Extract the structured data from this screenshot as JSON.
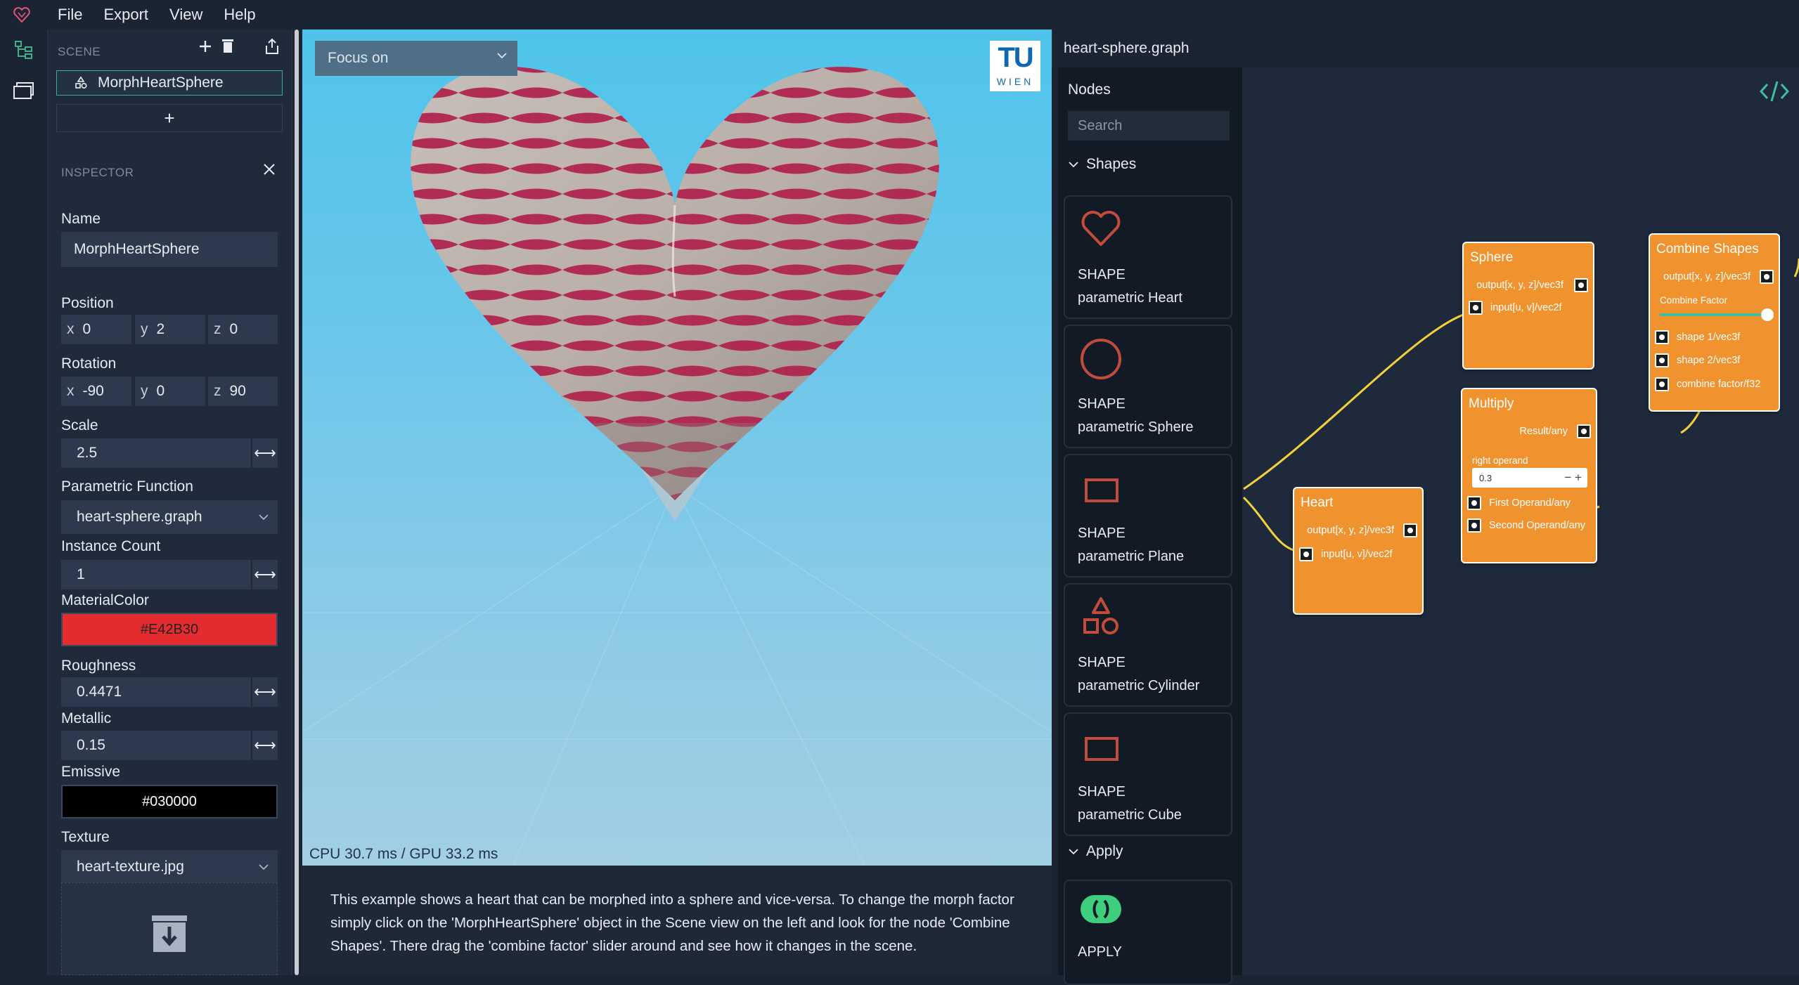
{
  "menu": {
    "items": [
      "File",
      "Export",
      "View",
      "Help"
    ]
  },
  "scene": {
    "header": "SCENE",
    "selected_item": "MorphHeartSphere",
    "add_label": "+"
  },
  "inspector": {
    "header": "INSPECTOR",
    "name_label": "Name",
    "name_value": "MorphHeartSphere",
    "position_label": "Position",
    "position": {
      "x": "0",
      "y": "2",
      "z": "0"
    },
    "rotation_label": "Rotation",
    "rotation": {
      "x": "-90",
      "y": "0",
      "z": "90"
    },
    "scale_label": "Scale",
    "scale_value": "2.5",
    "param_fn_label": "Parametric Function",
    "param_fn_value": "heart-sphere.graph",
    "instance_label": "Instance Count",
    "instance_value": "1",
    "material_label": "MaterialColor",
    "material_value": "#E42B30",
    "roughness_label": "Roughness",
    "roughness_value": "0.4471",
    "metallic_label": "Metallic",
    "metallic_value": "0.15",
    "emissive_label": "Emissive",
    "emissive_value": "#030000",
    "texture_label": "Texture",
    "texture_value": "heart-texture.jpg",
    "axis": {
      "x": "x",
      "y": "y",
      "z": "z"
    }
  },
  "viewport": {
    "focus_label": "Focus on",
    "perf": "CPU 30.7 ms / GPU 33.2 ms",
    "logo_top": "TU",
    "logo_bottom": "WIEN"
  },
  "description": "This example shows a heart that can be morphed into a sphere and vice-versa. To change the morph factor simply click on the 'MorphHeartSphere' object in the Scene view on the left and look for the node 'Combine Shapes'. There drag the 'combine factor' slider around and see how it changes in the scene.",
  "graph": {
    "filename": "heart-sphere.graph",
    "nodes_title": "Nodes",
    "search_placeholder": "Search",
    "categories": {
      "shapes": "Shapes",
      "apply": "Apply"
    },
    "cards": [
      {
        "kind": "SHAPE",
        "name": "parametric Heart",
        "icon": "heart-icon"
      },
      {
        "kind": "SHAPE",
        "name": "parametric Sphere",
        "icon": "circle-icon"
      },
      {
        "kind": "SHAPE",
        "name": "parametric Plane",
        "icon": "rectangle-icon"
      },
      {
        "kind": "SHAPE",
        "name": "parametric Cylinder",
        "icon": "shapes-icon"
      },
      {
        "kind": "SHAPE",
        "name": "parametric Cube",
        "icon": "square-icon"
      },
      {
        "kind": "APPLY",
        "name": "",
        "icon": "apply-icon"
      }
    ],
    "node_heart": {
      "title": "Heart",
      "out": "output[x, y, z]/vec3f",
      "in": "input[u, v]/vec2f"
    },
    "node_sphere": {
      "title": "Sphere",
      "out": "output[x, y, z]/vec3f",
      "in": "input[u, v]/vec2f"
    },
    "node_multiply": {
      "title": "Multiply",
      "out": "Result/any",
      "right_label": "right operand",
      "right_value": "0.3",
      "in1": "First Operand/any",
      "in2": "Second Operand/any"
    },
    "node_combine": {
      "title": "Combine Shapes",
      "out": "output[x, y, z]/vec3f",
      "factor_label": "Combine Factor",
      "factor_value": 0.95,
      "in1": "shape 1/vec3f",
      "in2": "shape 2/vec3f",
      "in3": "combine factor/f32"
    }
  },
  "colors": {
    "accent": "#3fae8a",
    "node": "#f0932f",
    "material": "#E42B30",
    "emissive": "#030000",
    "wire": "#f2d13a",
    "icon_red": "#c24b3c"
  }
}
